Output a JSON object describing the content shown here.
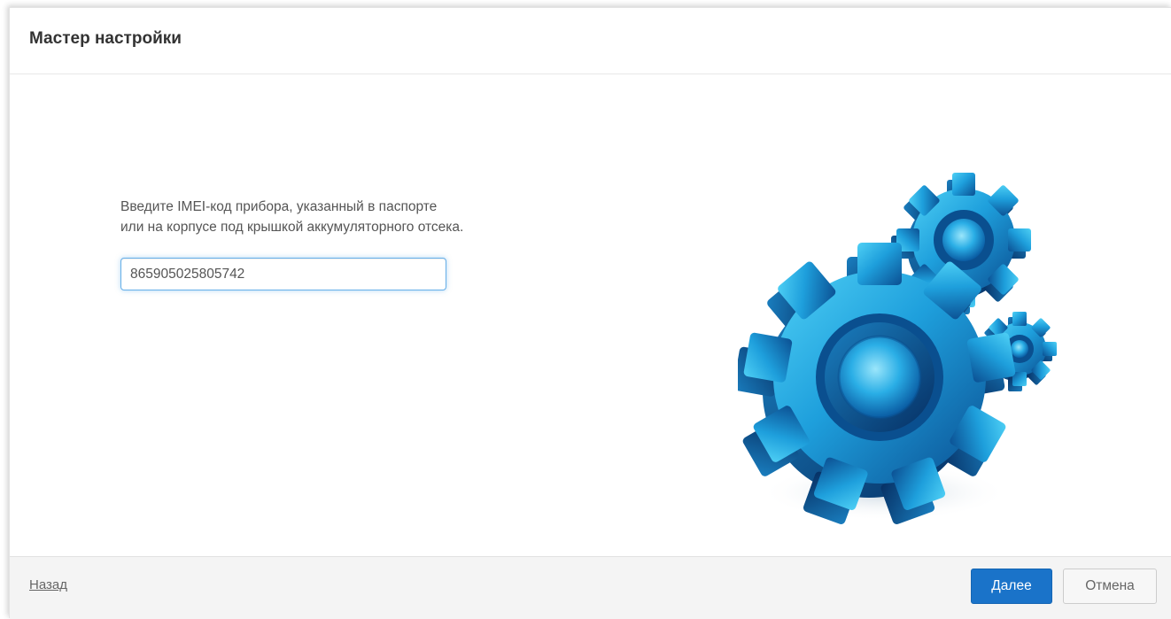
{
  "dialog": {
    "title": "Мастер настройки"
  },
  "main": {
    "instruction_line1": "Введите IMEI-код прибора, указанный в паспорте",
    "instruction_line2": "или на корпусе под крышкой аккумуляторного отсека.",
    "imei_value": "865905025805742",
    "illustration_icon": "gears-icon"
  },
  "footer": {
    "back_label": "Назад",
    "next_label": "Далее",
    "cancel_label": "Отмена"
  },
  "colors": {
    "primary_button": "#1a73c9",
    "gear_blue": "#1e9fdc",
    "input_focus_border": "#66afe9"
  }
}
